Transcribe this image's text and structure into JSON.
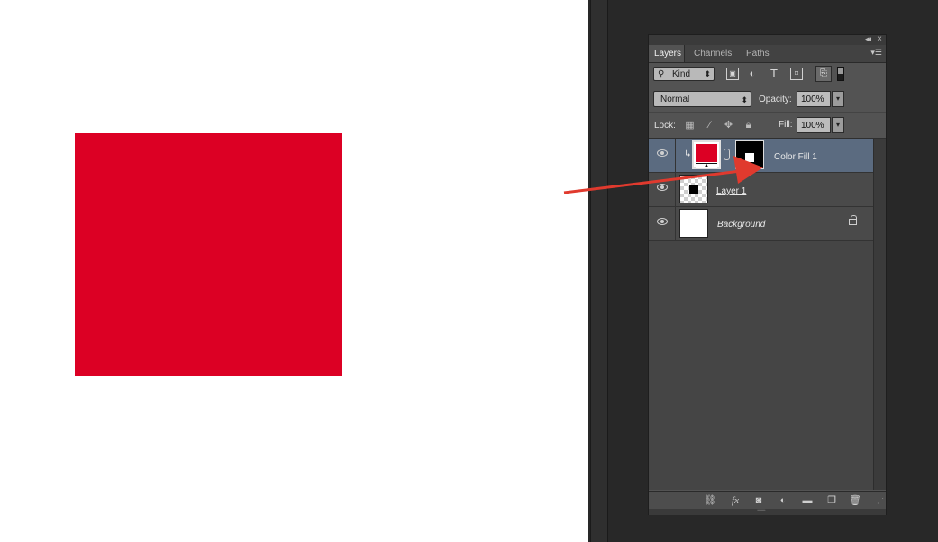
{
  "canvas": {
    "fill_color": "#dc0024",
    "background_color": "#ffffff"
  },
  "panel": {
    "collapse_icon": "double-chevron-left-icon",
    "close_icon": "close-icon",
    "tabs": [
      {
        "label": "Layers",
        "active": true
      },
      {
        "label": "Channels",
        "active": false
      },
      {
        "label": "Paths",
        "active": false
      }
    ],
    "filter": {
      "kind_label": "Kind",
      "icons": [
        "image-filter-icon",
        "adjustment-filter-icon",
        "type-filter-icon",
        "shape-filter-icon",
        "smart-object-filter-icon"
      ]
    },
    "blend_mode": "Normal",
    "opacity_label": "Opacity:",
    "opacity_value": "100%",
    "lock_label": "Lock:",
    "fill_label": "Fill:",
    "fill_value": "100%",
    "layers": [
      {
        "name": "Color Fill 1",
        "selected": true,
        "type": "color-fill",
        "fill_color": "#dc0024",
        "has_mask": true,
        "clipped": true
      },
      {
        "name": "Layer 1",
        "selected": false,
        "type": "pixel"
      },
      {
        "name": "Background",
        "selected": false,
        "type": "background",
        "locked": true
      }
    ],
    "bottom_icons": [
      "link-layers-icon",
      "fx-icon",
      "add-mask-icon",
      "adjustment-layer-icon",
      "new-group-icon",
      "new-layer-icon",
      "trash-icon"
    ]
  },
  "annotation": {
    "arrow_color": "#e03a2e"
  }
}
